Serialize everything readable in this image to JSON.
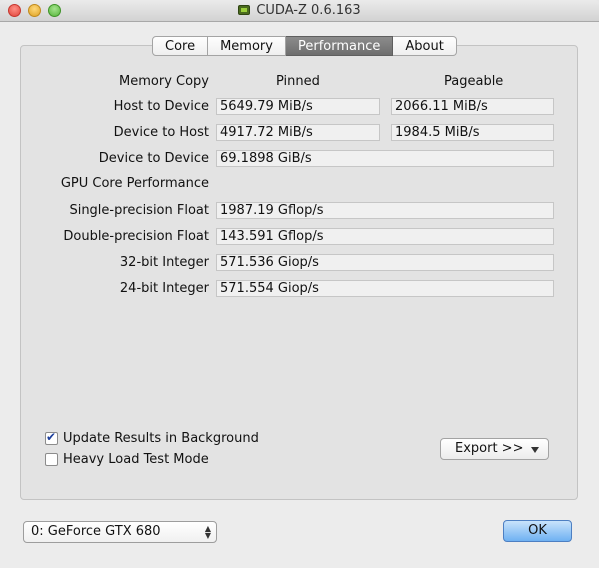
{
  "window": {
    "title": "CUDA-Z 0.6.163"
  },
  "tabs": [
    {
      "label": "Core",
      "active": false
    },
    {
      "label": "Memory",
      "active": false
    },
    {
      "label": "Performance",
      "active": true
    },
    {
      "label": "About",
      "active": false
    }
  ],
  "perf": {
    "memory_copy": "Memory Copy",
    "pinned": "Pinned",
    "pageable": "Pageable",
    "rows": [
      {
        "label": "Host to Device",
        "pinned": "5649.79 MiB/s",
        "pageable": "2066.11 MiB/s"
      },
      {
        "label": "Device to Host",
        "pinned": "4917.72 MiB/s",
        "pageable": "1984.5 MiB/s"
      },
      {
        "label": "Device to Device",
        "value": "69.1898 GiB/s"
      }
    ],
    "gpu_core": "GPU Core Performance",
    "core_rows": [
      {
        "label": "Single-precision Float",
        "value": "1987.19 Gflop/s"
      },
      {
        "label": "Double-precision Float",
        "value": "143.591 Gflop/s"
      },
      {
        "label": "32-bit Integer",
        "value": "571.536 Giop/s"
      },
      {
        "label": "24-bit Integer",
        "value": "571.554 Giop/s"
      }
    ]
  },
  "options": {
    "update_bg": {
      "label": "Update Results in Background",
      "checked": true
    },
    "heavy_load": {
      "label": "Heavy Load Test Mode",
      "checked": false
    }
  },
  "export_label": "Export >>",
  "device_select": "0: GeForce GTX 680",
  "ok_label": "OK",
  "icons": {
    "app": "cuda-z-icon",
    "check": "checkmark-icon",
    "dropdown": "triangle-down-icon",
    "updown": "up-down-arrows-icon"
  }
}
